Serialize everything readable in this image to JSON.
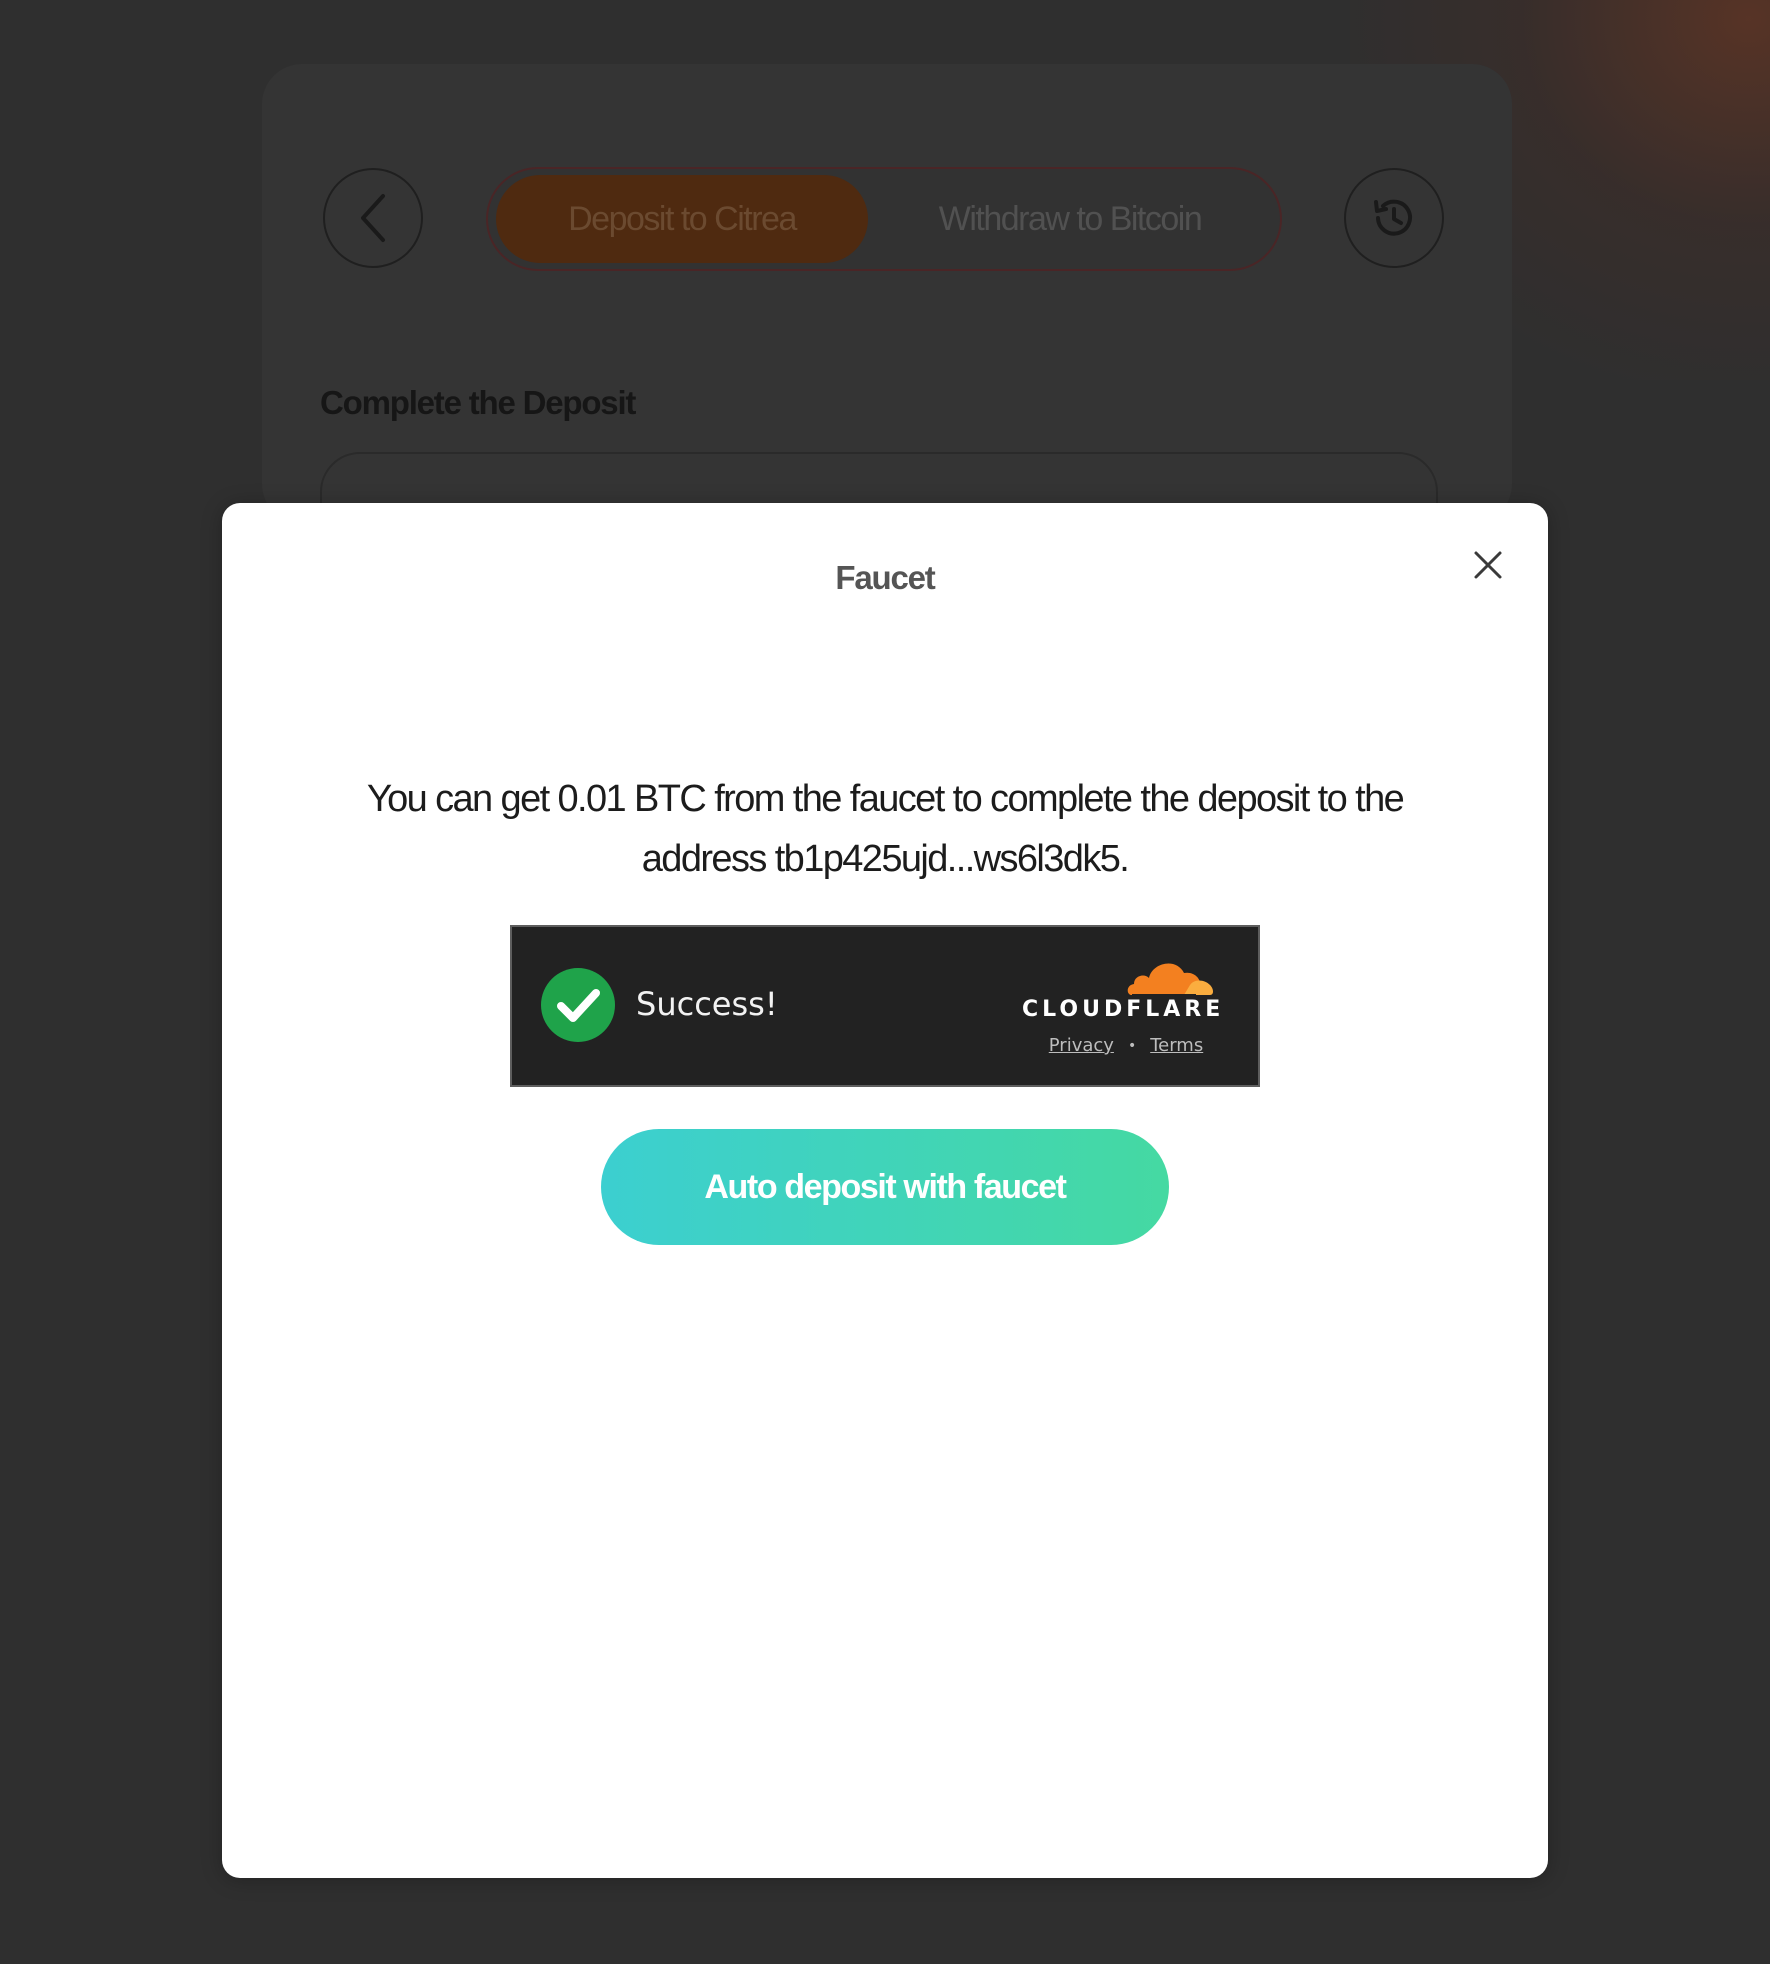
{
  "background": {
    "tabs": [
      {
        "label": "Deposit to Citrea",
        "active": true
      },
      {
        "label": "Withdraw to Bitcoin",
        "active": false
      }
    ],
    "heading": "Complete the Deposit",
    "icons": {
      "back": "chevron-left-icon",
      "history": "history-icon"
    }
  },
  "modal": {
    "title": "Faucet",
    "message": "You can get 0.01 BTC from the faucet to complete the deposit to the address tb1p425ujd...ws6l3dk5.",
    "captcha": {
      "status": "Success!",
      "brand": "CLOUDFLARE",
      "privacy_label": "Privacy",
      "separator": "•",
      "terms_label": "Terms"
    },
    "action_label": "Auto deposit with faucet",
    "icons": {
      "close": "close-icon",
      "check": "check-circle-icon",
      "logo": "cloudflare-logo"
    }
  },
  "colors": {
    "overlay": "#2f2f2f",
    "active_tab": "#4f2a10",
    "success_green": "#1fa34a",
    "cloudflare_orange": "#f38020",
    "button_gradient_start": "#3ccfd0",
    "button_gradient_end": "#45d9a2"
  }
}
